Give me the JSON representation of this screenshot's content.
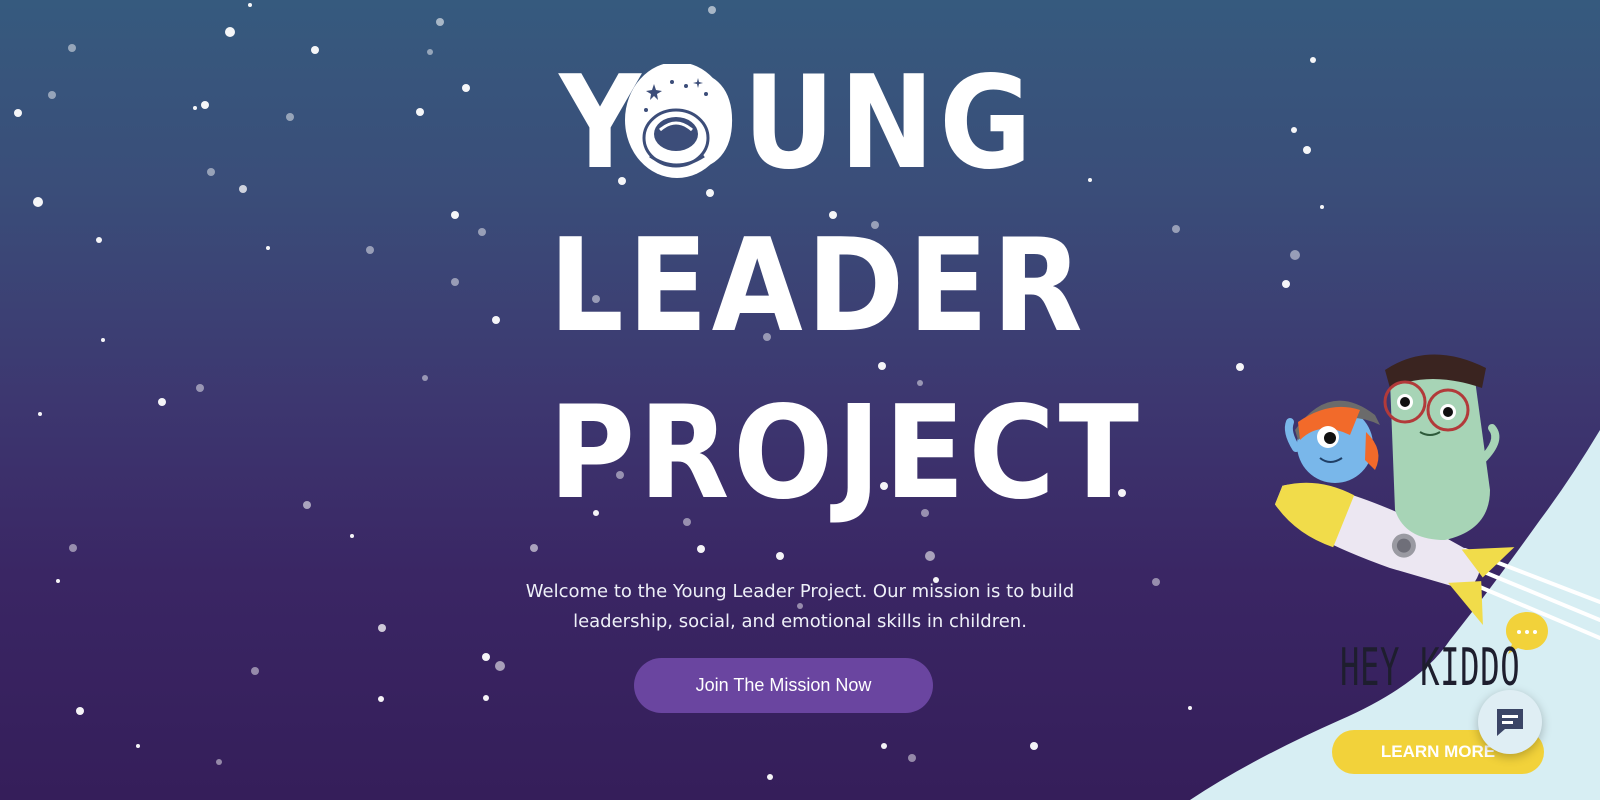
{
  "hero": {
    "title_line1": "YOUNG",
    "title_line2": "LEADER",
    "title_line3": "PROJECT",
    "tagline": "Welcome to the Young Leader Project. Our mission is to build leadership, social, and emotional skills in children.",
    "cta_label": "Join The Mission Now"
  },
  "promo": {
    "heading": "HEY KIDDO",
    "button_label": "LEARN MORE"
  },
  "icons": {
    "astronaut_helmet": "astronaut-helmet-icon",
    "speech_bubble": "speech-bubble-icon",
    "chat": "chat-icon"
  },
  "colors": {
    "bg_top": "#365a7e",
    "bg_bottom": "#351e5a",
    "cta": "#6a45a0",
    "promo_button": "#f2d23a",
    "promo_blob": "#d7eef3"
  }
}
